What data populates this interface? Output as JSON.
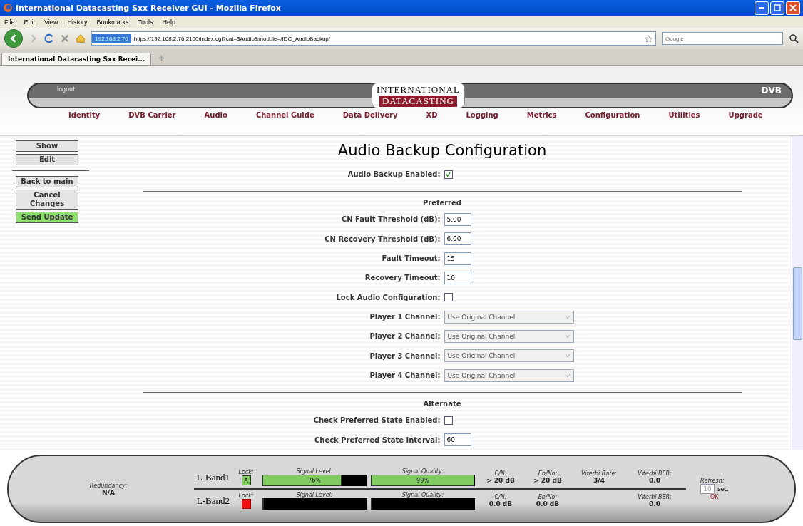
{
  "window": {
    "title": "International Datacasting Sxx Receiver GUI - Mozilla Firefox"
  },
  "menu": [
    "File",
    "Edit",
    "View",
    "History",
    "Bookmarks",
    "Tools",
    "Help"
  ],
  "address": {
    "site": "192.168.2.76",
    "url": "https://192.168.2.76:2100/index.cgi?cat=3Audio&module=/IDC_AudioBackup/"
  },
  "search": {
    "placeholder": "Google"
  },
  "tabs": [
    {
      "label": "International Datacasting Sxx Recei...",
      "selected": true
    }
  ],
  "header": {
    "logout": "logout",
    "logo_top": "INTERNATIONAL",
    "logo_bottom": "DATACASTING",
    "badge": "DVB",
    "nav": [
      "Identity",
      "DVB Carrier",
      "Audio",
      "Channel Guide",
      "Data Delivery",
      "XD",
      "Logging",
      "Metrics",
      "Configuration",
      "Utilities",
      "Upgrade"
    ]
  },
  "side_buttons": [
    {
      "label": "Show",
      "kind": "plain"
    },
    {
      "label": "Edit",
      "kind": "plain"
    },
    {
      "kind": "divider"
    },
    {
      "label": "Back to main",
      "kind": "plain"
    },
    {
      "label": "Cancel Changes",
      "kind": "plain"
    },
    {
      "label": "Send Update",
      "kind": "primary"
    }
  ],
  "heading": "Audio Backup Configuration",
  "sections": [
    {
      "rows": [
        {
          "kind": "checkbox",
          "label": "Audio Backup Enabled:",
          "checked": true
        }
      ]
    },
    {
      "title": "Preferred",
      "rows": [
        {
          "kind": "text",
          "label": "CN Fault Threshold (dB):",
          "value": "5.00"
        },
        {
          "kind": "text",
          "label": "CN Recovery Threshold (dB):",
          "value": "6.00"
        },
        {
          "kind": "text",
          "label": "Fault Timeout:",
          "value": "15"
        },
        {
          "kind": "text",
          "label": "Recovery Timeout:",
          "value": "10"
        },
        {
          "kind": "checkbox",
          "label": "Lock Audio Configuration:",
          "checked": false
        },
        {
          "kind": "select",
          "label": "Player 1 Channel:",
          "value": "Use Original Channel",
          "disabled": true
        },
        {
          "kind": "select",
          "label": "Player 2 Channel:",
          "value": "Use Original Channel",
          "disabled": true
        },
        {
          "kind": "select",
          "label": "Player 3 Channel:",
          "value": "Use Original Channel",
          "disabled": true
        },
        {
          "kind": "select",
          "label": "Player 4 Channel:",
          "value": "Use Original Channel",
          "disabled": true
        }
      ]
    },
    {
      "title": "Alternate",
      "rows": [
        {
          "kind": "checkbox",
          "label": "Check Preferred State Enabled:",
          "checked": false
        },
        {
          "kind": "text",
          "label": "Check Preferred State Interval:",
          "value": "60"
        }
      ]
    }
  ],
  "status": {
    "redundancy_label": "Redundancy:",
    "redundancy_value": "N/A",
    "bands": [
      {
        "name": "L-Band1",
        "lock_label": "Lock:",
        "locked": true,
        "lock_text": "A",
        "signal_label": "Signal Level:",
        "signal": {
          "level": 0.76,
          "reading": "76%"
        },
        "quality_label": "Signal Quality:",
        "quality": {
          "level": 0.99,
          "reading": "99%"
        },
        "cn_label": "C/N:",
        "cn": "> 20 dB",
        "ebno_label": "Eb/No:",
        "ebno": "> 20 dB",
        "viterbi_rate_label": "Viterbi Rate:",
        "viterbi_rate": "3/4",
        "ber_label": "Viterbi BER:",
        "ber": "0.0"
      },
      {
        "name": "L-Band2",
        "lock_label": "Lock:",
        "locked": false,
        "signal_label": "Signal Level:",
        "signal": {
          "level": 0
        },
        "quality_label": "Signal Quality:",
        "quality": {
          "level": 0
        },
        "cn_label": "C/N:",
        "cn": "0.0 dB",
        "ebno_label": "Eb/No:",
        "ebno": "0.0 dB",
        "ber_label": "Viterbi BER:",
        "ber": "0.0"
      }
    ],
    "refresh_label": "Refresh:",
    "refresh_value": "10",
    "refresh_unit": "sec.",
    "refresh_status": "OK"
  }
}
